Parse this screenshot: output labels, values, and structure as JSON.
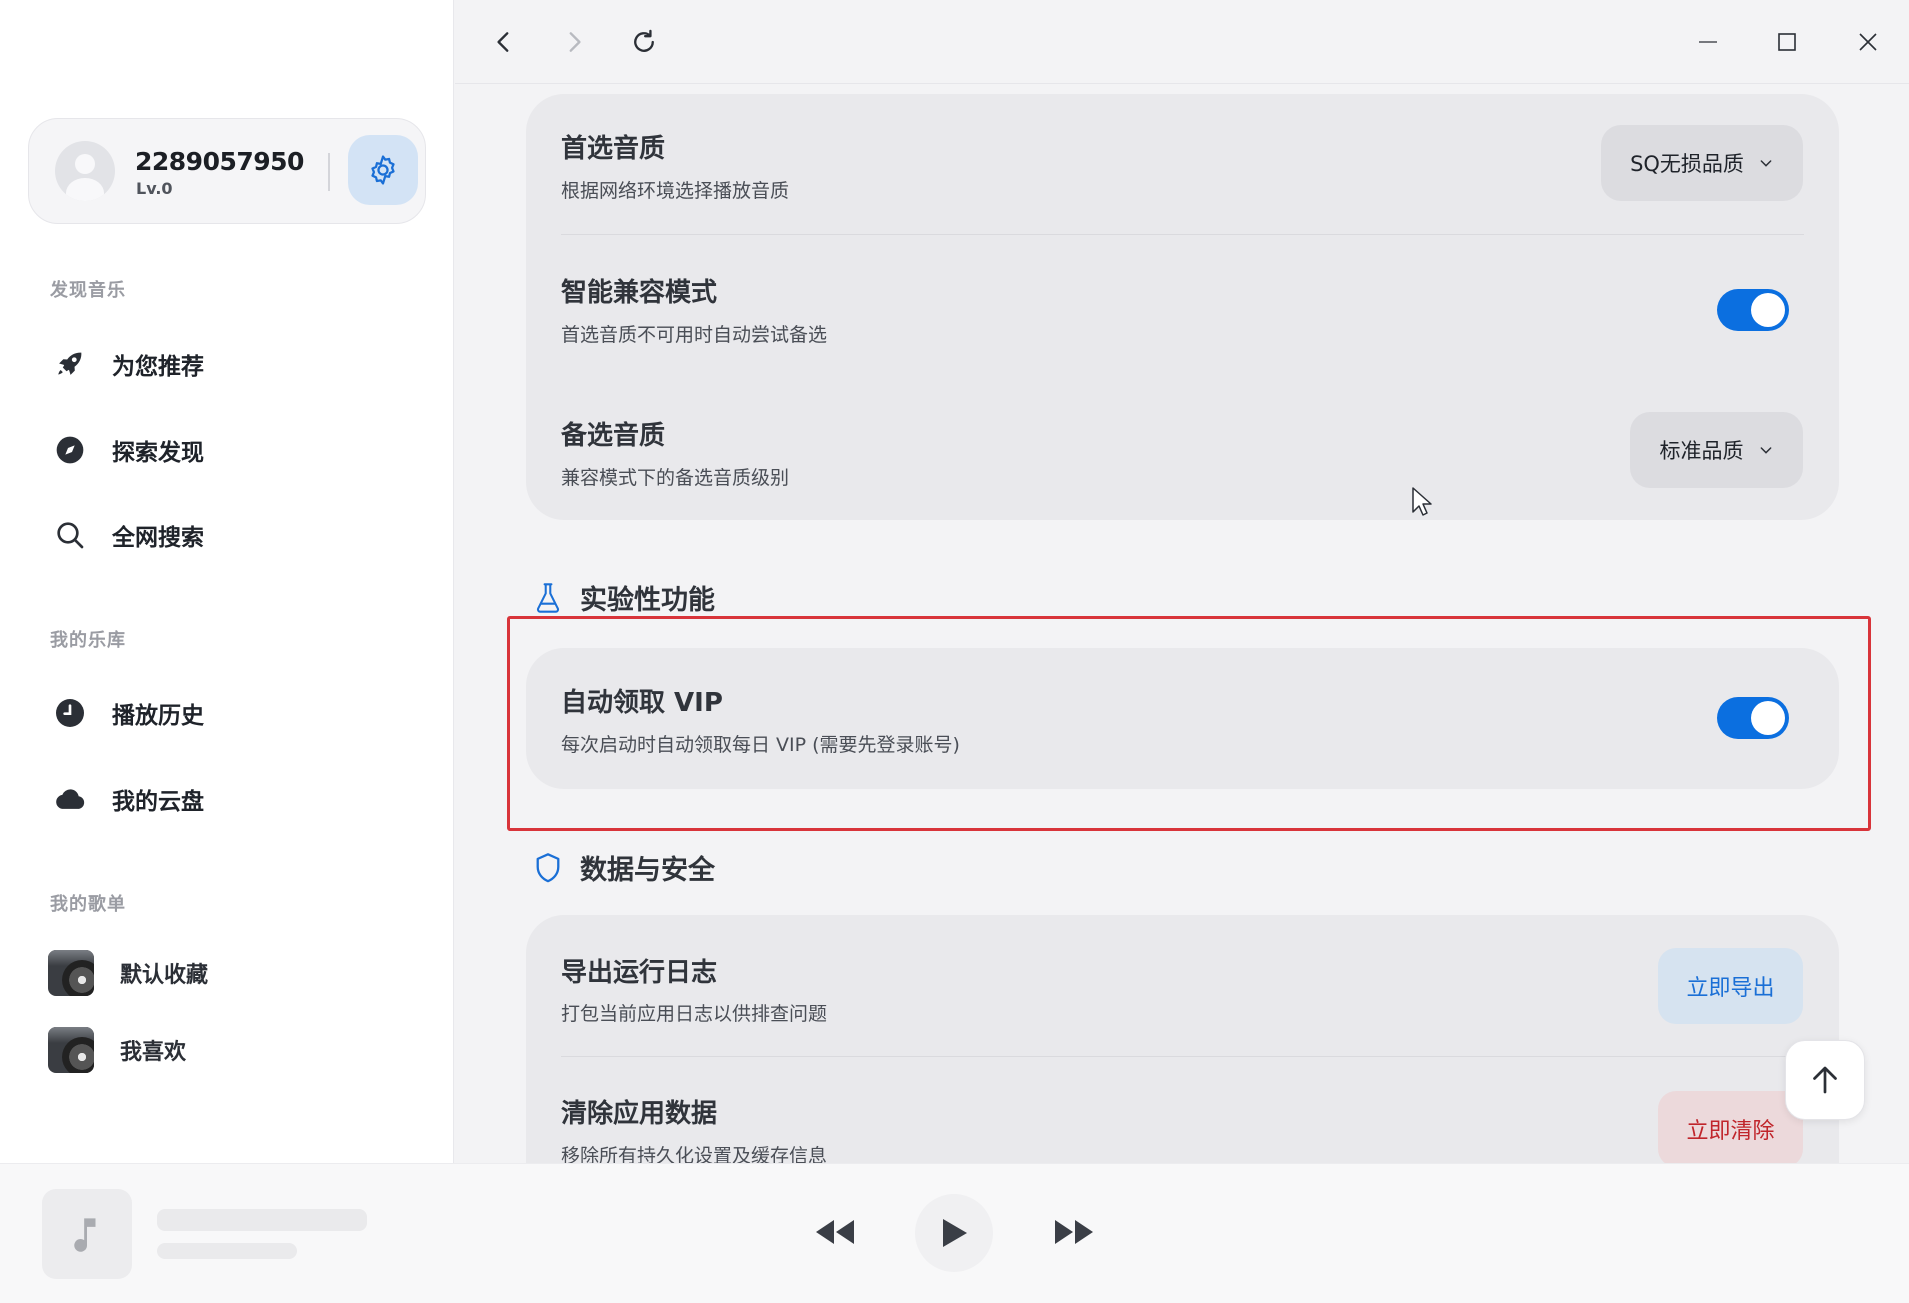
{
  "sidebar": {
    "profile": {
      "user_id": "2289057950",
      "level": "Lv.0"
    },
    "sections": {
      "discover": "发现音乐",
      "library": "我的乐库",
      "playlists": "我的歌单"
    },
    "discover_items": [
      {
        "label": "为您推荐",
        "icon": "rocket-icon"
      },
      {
        "label": "探索发现",
        "icon": "compass-icon"
      },
      {
        "label": "全网搜索",
        "icon": "search-icon"
      }
    ],
    "library_items": [
      {
        "label": "播放历史",
        "icon": "clock-icon"
      },
      {
        "label": "我的云盘",
        "icon": "cloud-icon"
      }
    ],
    "playlist_items": [
      {
        "label": "默认收藏"
      },
      {
        "label": "我喜欢"
      }
    ]
  },
  "settings": {
    "quality_card": {
      "preferred": {
        "title": "首选音质",
        "desc": "根据网络环境选择播放音质",
        "value": "SQ无损品质"
      },
      "smart_compat": {
        "title": "智能兼容模式",
        "desc": "首选音质不可用时自动尝试备选",
        "enabled": true
      },
      "fallback": {
        "title": "备选音质",
        "desc": "兼容模式下的备选音质级别",
        "value": "标准品质"
      }
    },
    "experimental": {
      "heading": "实验性功能",
      "auto_vip": {
        "title": "自动领取 VIP",
        "desc": "每次启动时自动领取每日 VIP (需要先登录账号)",
        "enabled": true
      }
    },
    "data_security": {
      "heading": "数据与安全",
      "export_logs": {
        "title": "导出运行日志",
        "desc": "打包当前应用日志以供排查问题",
        "button": "立即导出"
      },
      "clear_data": {
        "title": "清除应用数据",
        "desc": "移除所有持久化设置及缓存信息",
        "button": "立即清除"
      }
    }
  },
  "colors": {
    "accent": "#0b6fe0",
    "danger_text": "#c0252b",
    "highlight_border": "#d8343a"
  }
}
